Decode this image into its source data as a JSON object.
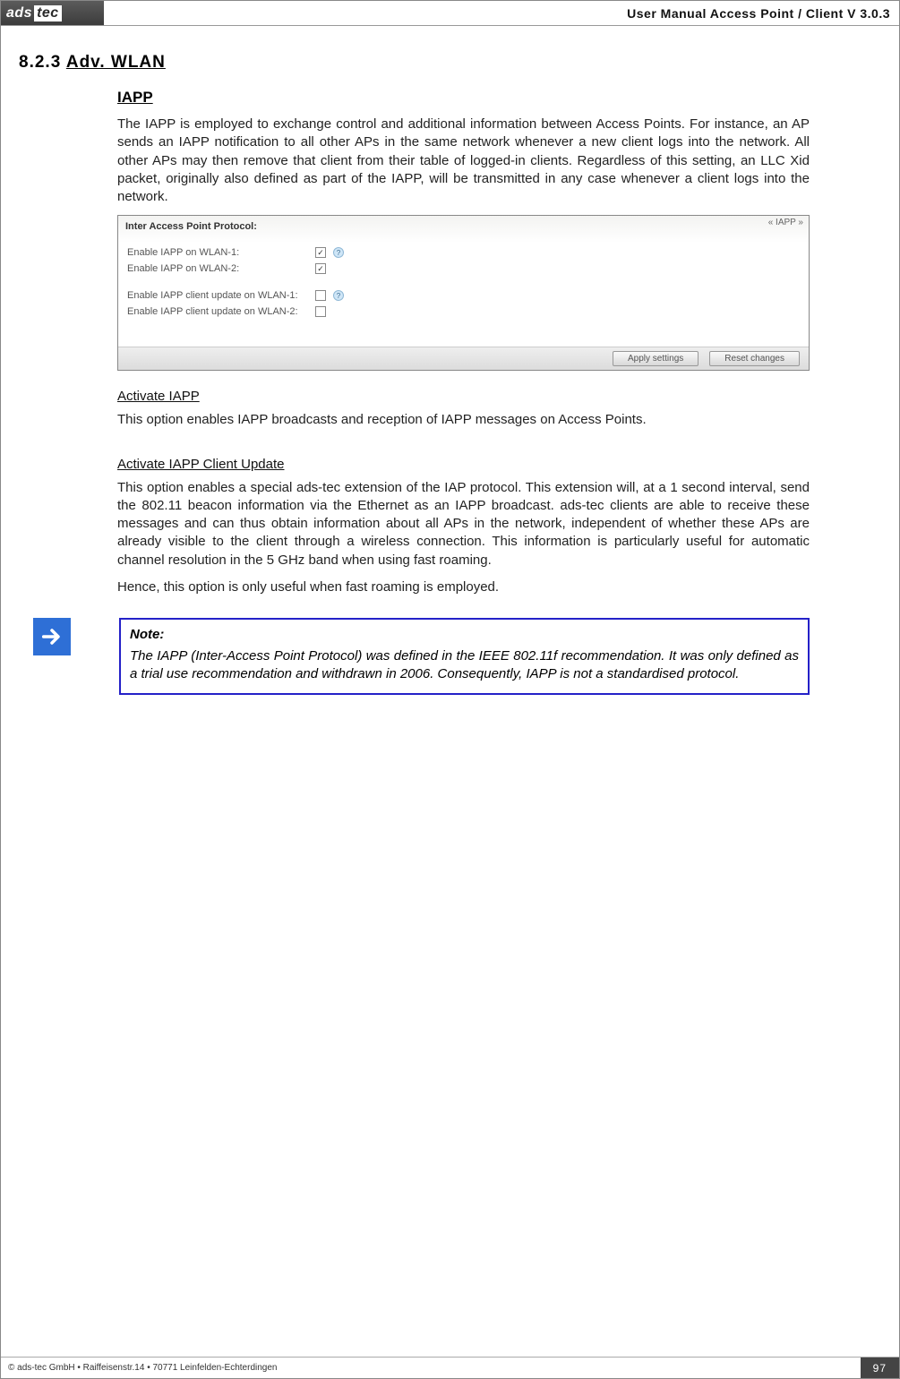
{
  "header": {
    "logo_ads": "ads",
    "logo_tec": "tec",
    "title": "User Manual Access  Point / Client V 3.0.3"
  },
  "section": {
    "number": "8.2.3",
    "title": "Adv. WLAN"
  },
  "iapp": {
    "title": "IAPP",
    "intro": "The IAPP is employed to exchange control and additional information between Access Points. For instance, an AP sends an IAPP notification to all other APs in the same network whenever a new client logs into the network. All other APs may then remove that client from their table of logged-in clients. Regardless of this setting, an LLC Xid packet, originally also defined as part of the IAPP, will be transmitted in any case whenever a client logs into the network."
  },
  "panel": {
    "tag": "« IAPP »",
    "header": "Inter Access Point Protocol:",
    "rows": [
      {
        "label": "Enable IAPP on WLAN-1:",
        "checked": true,
        "help": true
      },
      {
        "label": "Enable IAPP on WLAN-2:",
        "checked": true,
        "help": false
      }
    ],
    "rows2": [
      {
        "label": "Enable IAPP client update on WLAN-1:",
        "checked": false,
        "help": true
      },
      {
        "label": "Enable IAPP client update on WLAN-2:",
        "checked": false,
        "help": false
      }
    ],
    "buttons": {
      "apply": "Apply settings",
      "reset": "Reset changes"
    }
  },
  "activate": {
    "title": "Activate IAPP",
    "text": "This option enables IAPP broadcasts and reception of IAPP messages on Access Points."
  },
  "client_update": {
    "title": "Activate IAPP Client Update",
    "text": "This option enables a special ads-tec extension of the IAP protocol. This extension will, at a 1 second interval, send the 802.11 beacon information via the Ethernet as an IAPP broadcast. ads-tec clients are able to receive these messages and can thus obtain information about all APs in the network, independent of whether these APs are already visible to the client through a wireless connection. This information is particularly useful for automatic channel resolution in the 5 GHz band when using fast roaming.",
    "text2": "Hence, this option is only useful when fast roaming is employed."
  },
  "note": {
    "label": "Note:",
    "text": "The IAPP (Inter-Access Point Protocol) was defined in the IEEE 802.11f recommendation. It was only defined as a trial use recommendation and withdrawn in 2006. Consequently, IAPP is not a standardised protocol."
  },
  "footer": {
    "left": "© ads-tec GmbH • Raiffeisenstr.14 • 70771 Leinfelden-Echterdingen",
    "page": "97"
  }
}
